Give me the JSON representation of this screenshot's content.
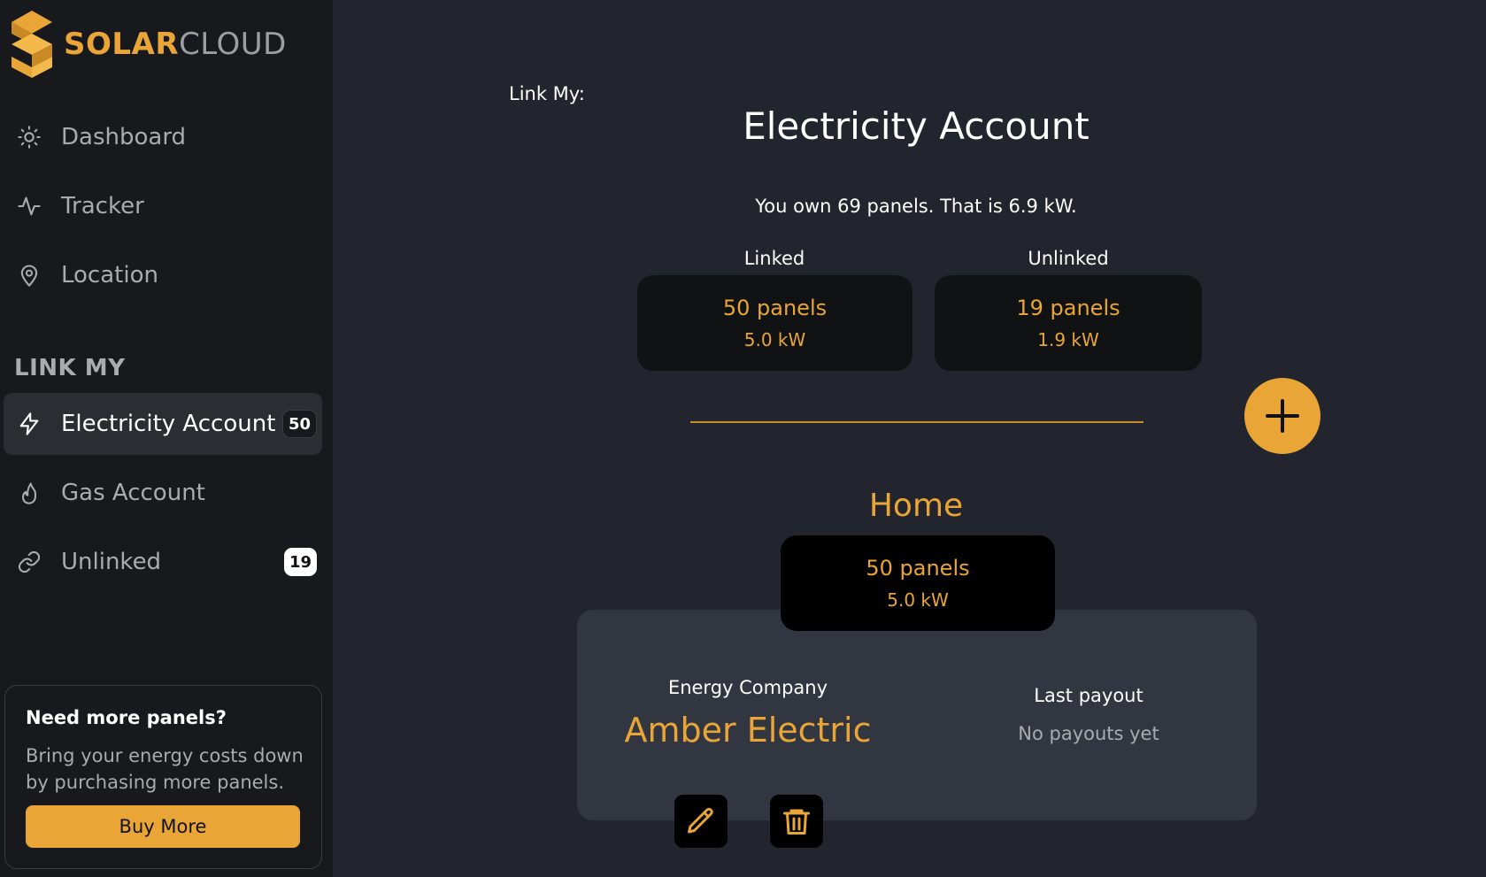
{
  "brand": {
    "part1": "SOLAR",
    "part2": "CLOUD"
  },
  "colors": {
    "accent": "#e9a637",
    "sidebar_bg": "#18191d",
    "main_bg": "#22252d",
    "card_bg": "#313641"
  },
  "sidebar": {
    "nav": [
      {
        "label": "Dashboard",
        "icon": "sun-icon"
      },
      {
        "label": "Tracker",
        "icon": "activity-icon"
      },
      {
        "label": "Location",
        "icon": "map-pin-icon"
      }
    ],
    "section_title": "LINK MY",
    "link_items": [
      {
        "label": "Electricity Account",
        "icon": "lightning-icon",
        "badge": "50",
        "active": true
      },
      {
        "label": "Gas Account",
        "icon": "flame-icon"
      },
      {
        "label": "Unlinked",
        "icon": "link-icon",
        "badge": "19"
      }
    ],
    "promo": {
      "title": "Need more panels?",
      "text": "Bring your energy costs down by purchasing more panels.",
      "button": "Buy More"
    }
  },
  "main": {
    "link_label": "Link My:",
    "title": "Electricity Account",
    "summary": "You own 69 panels. That is 6.9 kW.",
    "linked": {
      "label": "Linked",
      "panels": "50 panels",
      "kw": "5.0 kW"
    },
    "unlinked": {
      "label": "Unlinked",
      "panels": "19 panels",
      "kw": "1.9 kW"
    },
    "account": {
      "name": "Home",
      "panels": "50 panels",
      "kw": "5.0 kW",
      "company_label": "Energy Company",
      "company": "Amber Electric",
      "payout_label": "Last payout",
      "payout_value": "No payouts yet"
    }
  }
}
